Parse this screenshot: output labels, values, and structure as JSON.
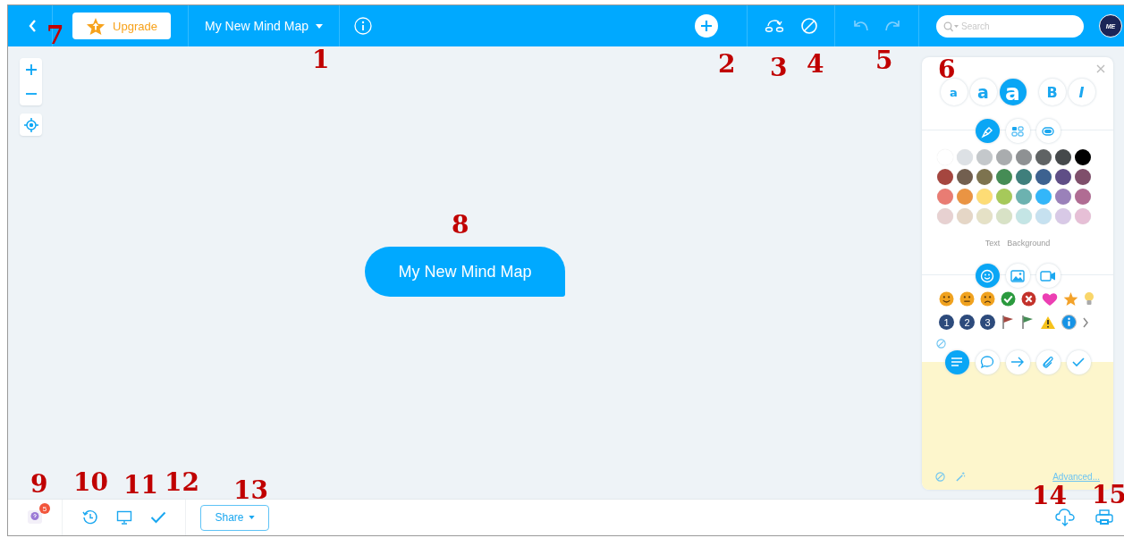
{
  "topbar": {
    "upgrade_button": "Upgrade",
    "map_title": "My New Mind Map",
    "search": {
      "placeholder": "Search"
    },
    "avatar_initials": "ME"
  },
  "central_topic": "My New Mind Map",
  "format_panel": {
    "font_sizes": [
      {
        "label": "a",
        "selected": false
      },
      {
        "label": "a",
        "selected": false
      },
      {
        "label": "a",
        "selected": true
      }
    ],
    "font_styles": [
      {
        "label": "B",
        "kind": "bold",
        "selected": false
      },
      {
        "label": "I",
        "kind": "italic",
        "selected": false
      }
    ],
    "style_tabs": [
      {
        "kind": "brush",
        "selected": true
      },
      {
        "kind": "layout",
        "selected": false
      },
      {
        "kind": "shape",
        "selected": false
      }
    ],
    "swatch_rows": [
      [
        {
          "color": "#ffffff"
        },
        {
          "color": "#dde1e5"
        },
        {
          "color": "#c4c8cb"
        },
        {
          "color": "#a9acae"
        },
        {
          "color": "#8e9193"
        },
        {
          "color": "#5f6364"
        },
        {
          "color": "#45494b"
        },
        {
          "color": "#000000"
        }
      ],
      [
        {
          "color": "#a5463f"
        },
        {
          "color": "#725f4f"
        },
        {
          "color": "#7d734f"
        },
        {
          "color": "#458c55"
        },
        {
          "color": "#3f7f7c"
        },
        {
          "color": "#3d6290"
        },
        {
          "color": "#5f4e86"
        },
        {
          "color": "#7f4f6b"
        }
      ],
      [
        {
          "color": "#e97c73"
        },
        {
          "color": "#ea9443"
        },
        {
          "color": "#fddc75"
        },
        {
          "color": "#a6c95a"
        },
        {
          "color": "#6cb2b0"
        },
        {
          "color": "#33b6f9"
        },
        {
          "color": "#9a81b9"
        },
        {
          "color": "#b06c93"
        }
      ],
      [
        {
          "color": "#e7d1d1"
        },
        {
          "color": "#e5d6c6"
        },
        {
          "color": "#e5e1c6"
        },
        {
          "color": "#d8e2c6"
        },
        {
          "color": "#c4e5e5"
        },
        {
          "color": "#c6e1f0"
        },
        {
          "color": "#d8c9e6"
        },
        {
          "color": "#e6bfd6"
        }
      ]
    ],
    "color_targets": [
      "Text",
      "Background"
    ],
    "media_tabs": [
      {
        "kind": "emoji",
        "selected": true
      },
      {
        "kind": "image",
        "selected": false
      },
      {
        "kind": "video",
        "selected": false
      }
    ],
    "icon_rows": [
      [
        {
          "kind": "smile"
        },
        {
          "kind": "neutral"
        },
        {
          "kind": "sad"
        },
        {
          "kind": "check"
        },
        {
          "kind": "cross"
        },
        {
          "kind": "heart"
        },
        {
          "kind": "star"
        },
        {
          "kind": "bulb"
        }
      ],
      [
        {
          "kind": "number",
          "label": "1"
        },
        {
          "kind": "number",
          "label": "2"
        },
        {
          "kind": "number",
          "label": "3"
        },
        {
          "kind": "flag",
          "color": "#a5463f"
        },
        {
          "kind": "flag",
          "color": "#458c55"
        },
        {
          "kind": "warning"
        },
        {
          "kind": "info"
        },
        {
          "kind": "more"
        }
      ]
    ],
    "note_tabs": [
      {
        "kind": "notes",
        "selected": true
      },
      {
        "kind": "comment",
        "selected": false
      },
      {
        "kind": "link",
        "selected": false
      },
      {
        "kind": "attachment",
        "selected": false
      },
      {
        "kind": "task",
        "selected": false
      }
    ],
    "advanced_link": "Advanced..."
  },
  "bottombar": {
    "help_badge": "5",
    "share_button": "Share"
  },
  "callouts": [
    {
      "label": "7"
    },
    {
      "label": "1"
    },
    {
      "label": "2"
    },
    {
      "label": "3"
    },
    {
      "label": "4"
    },
    {
      "label": "5"
    },
    {
      "label": "6"
    },
    {
      "label": "8"
    },
    {
      "label": "9"
    },
    {
      "label": "10"
    },
    {
      "label": "11"
    },
    {
      "label": "12"
    },
    {
      "label": "13"
    },
    {
      "label": "14"
    },
    {
      "label": "15"
    }
  ]
}
